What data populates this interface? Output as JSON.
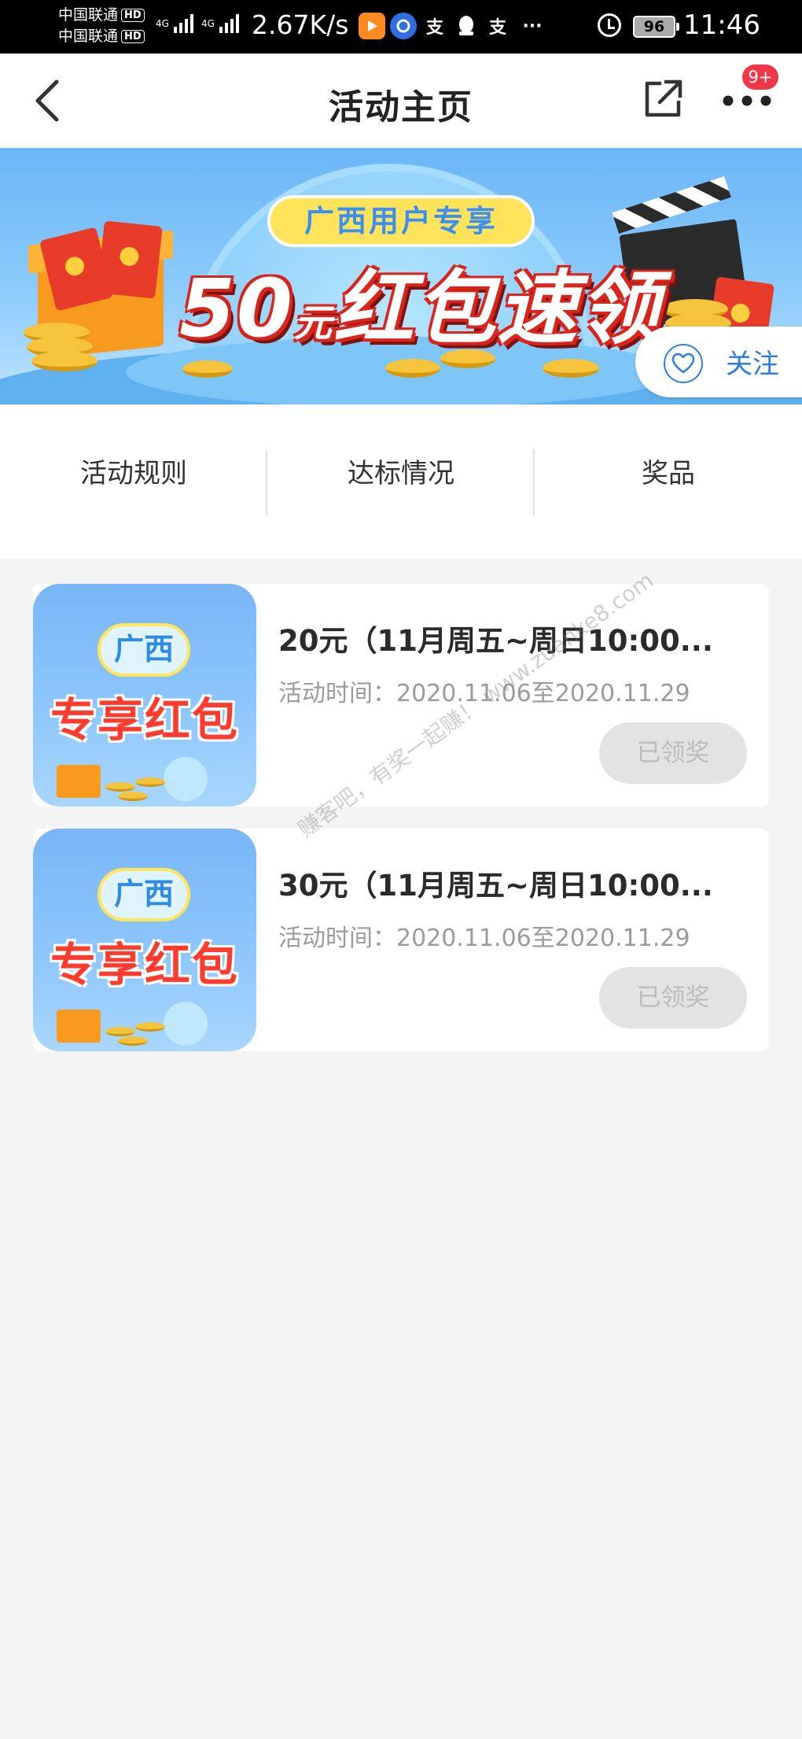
{
  "status_bar": {
    "carrier_1": "中国联通",
    "carrier_2": "中国联通",
    "hd_label": "HD",
    "network_1": "4G",
    "network_2": "4G",
    "net_speed": "2.67K/s",
    "app_icons": [
      "video-app-icon",
      "browser-app-icon",
      "alipay-icon",
      "qq-penguin-icon",
      "alipay-icon"
    ],
    "alipay_glyph": "支",
    "more_dots": "···",
    "battery_level": "96",
    "time": "11:46"
  },
  "nav": {
    "title": "活动主页",
    "badge": "9+",
    "icons": [
      "back-arrow-icon",
      "share-icon",
      "more-icon"
    ]
  },
  "banner": {
    "subtitle": "广西用户专享",
    "amount": "50",
    "unit": "元",
    "headline": "红包速领",
    "follow_label": "关注",
    "colors": {
      "sky": "#6bb6f7",
      "headline_red": "#d9241c",
      "pill_yellow": "#ffe35b"
    }
  },
  "tabs": [
    {
      "label": "活动规则"
    },
    {
      "label": "达标情况"
    },
    {
      "label": "奖品"
    }
  ],
  "activities": [
    {
      "thumb_badge": "广西",
      "thumb_title": "专享红包",
      "title": "20元（11月周五~周日10:00...",
      "time": "活动时间：2020.11.06至2020.11.29",
      "button": "已领奖"
    },
    {
      "thumb_badge": "广西",
      "thumb_title": "专享红包",
      "title": "30元（11月周五~周日10:00...",
      "time": "活动时间：2020.11.06至2020.11.29",
      "button": "已领奖"
    }
  ],
  "watermark": "赚客吧，有奖一起赚！ www.zuanke8.com",
  "colors": {
    "accent_blue": "#2e7de0",
    "badge_red": "#f0384a",
    "page_bg": "#f4f4f4"
  }
}
